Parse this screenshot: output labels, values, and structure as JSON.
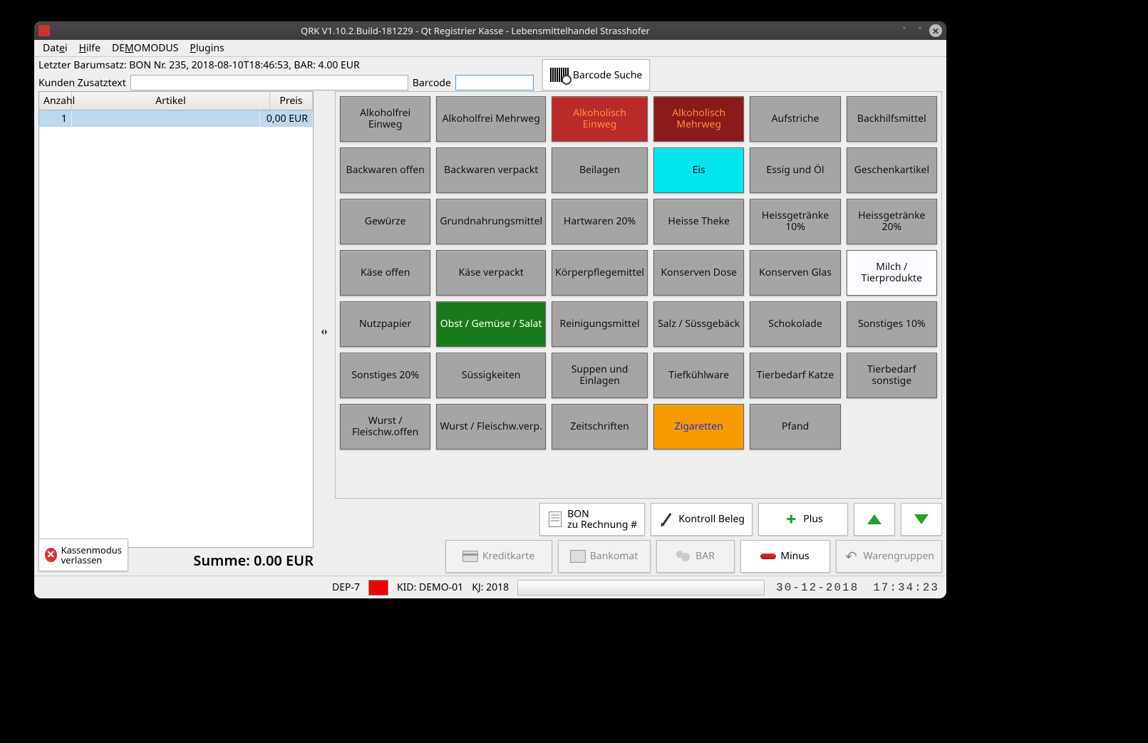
{
  "window": {
    "title": "QRK V1.10.2.Build-181229 - Qt Registrier Kasse - Lebensmittelhandel Strasshofer"
  },
  "menu": {
    "file": "Datei",
    "help": "Hilfe",
    "demo": "DEMOMODUS",
    "plugins": "Plugins"
  },
  "topbar": {
    "last_sale": "Letzter Barumsatz: BON Nr. 235, 2018-08-10T18:46:53, BAR: 4.00 EUR",
    "customer_label": "Kunden Zusatztext",
    "customer_value": "",
    "barcode_label": "Barcode",
    "barcode_value": "",
    "barcode_search": "Barcode Suche"
  },
  "table": {
    "headers": {
      "qty": "Anzahl",
      "article": "Artikel",
      "price": "Preis"
    },
    "rows": [
      {
        "qty": "1",
        "article": "",
        "price": "0,00 EUR"
      }
    ],
    "sum": "Summe: 0.00 EUR"
  },
  "categories": [
    {
      "label": "Alkoholfrei Einweg",
      "style": "gray"
    },
    {
      "label": "Alkoholfrei Mehrweg",
      "style": "gray"
    },
    {
      "label": "Alkoholisch Einweg",
      "style": "red-light"
    },
    {
      "label": "Alkoholisch Mehrweg",
      "style": "red-dark"
    },
    {
      "label": "Aufstriche",
      "style": "gray"
    },
    {
      "label": "Backhilfsmittel",
      "style": "gray"
    },
    {
      "label": "Backwaren offen",
      "style": "gray"
    },
    {
      "label": "Backwaren verpackt",
      "style": "gray"
    },
    {
      "label": "Beilagen",
      "style": "gray"
    },
    {
      "label": "Eis",
      "style": "cyan"
    },
    {
      "label": "Essig und Öl",
      "style": "gray"
    },
    {
      "label": "Geschenkartikel",
      "style": "gray"
    },
    {
      "label": "Gewürze",
      "style": "gray"
    },
    {
      "label": "Grundnahrungsmittel",
      "style": "gray"
    },
    {
      "label": "Hartwaren 20%",
      "style": "gray"
    },
    {
      "label": "Heisse Theke",
      "style": "gray"
    },
    {
      "label": "Heissgetränke 10%",
      "style": "gray"
    },
    {
      "label": "Heissgetränke 20%",
      "style": "gray"
    },
    {
      "label": "Käse offen",
      "style": "gray"
    },
    {
      "label": "Käse verpackt",
      "style": "gray"
    },
    {
      "label": "Körperpflegemittel",
      "style": "gray"
    },
    {
      "label": "Konserven Dose",
      "style": "gray"
    },
    {
      "label": "Konserven Glas",
      "style": "gray"
    },
    {
      "label": "Milch / Tierprodukte",
      "style": "white"
    },
    {
      "label": "Nutzpapier",
      "style": "gray"
    },
    {
      "label": "Obst / Gemüse / Salat",
      "style": "green"
    },
    {
      "label": "Reinigungsmittel",
      "style": "gray"
    },
    {
      "label": "Salz / Süssgebäck",
      "style": "gray"
    },
    {
      "label": "Schokolade",
      "style": "gray"
    },
    {
      "label": "Sonstiges 10%",
      "style": "gray"
    },
    {
      "label": "Sonstiges 20%",
      "style": "gray"
    },
    {
      "label": "Süssigkeiten",
      "style": "gray"
    },
    {
      "label": "Suppen und Einlagen",
      "style": "gray"
    },
    {
      "label": "Tiefkühlware",
      "style": "gray"
    },
    {
      "label": "Tierbedarf Katze",
      "style": "gray"
    },
    {
      "label": "Tierbedarf sonstige",
      "style": "gray"
    },
    {
      "label": "Wurst / Fleischw.offen",
      "style": "gray"
    },
    {
      "label": "Wurst / Fleischw.verp.",
      "style": "gray"
    },
    {
      "label": "Zeitschriften",
      "style": "gray"
    },
    {
      "label": "Zigaretten",
      "style": "orange"
    },
    {
      "label": "Pfand",
      "style": "gray"
    }
  ],
  "actions": {
    "bon_line1": "BON",
    "bon_line2": "zu Rechnung #",
    "kontroll": "Kontroll Beleg",
    "plus": "Plus",
    "kreditkarte": "Kreditkarte",
    "bankomat": "Bankomat",
    "bar": "BAR",
    "minus": "Minus",
    "warengruppen": "Warengruppen",
    "exit_line1": "Kassenmodus",
    "exit_line2": "verlassen"
  },
  "status": {
    "dep": "DEP-7",
    "kid": "KID: DEMO-01",
    "kj": "KJ: 2018",
    "date": "30-12-2018",
    "time": "17:34:23"
  }
}
